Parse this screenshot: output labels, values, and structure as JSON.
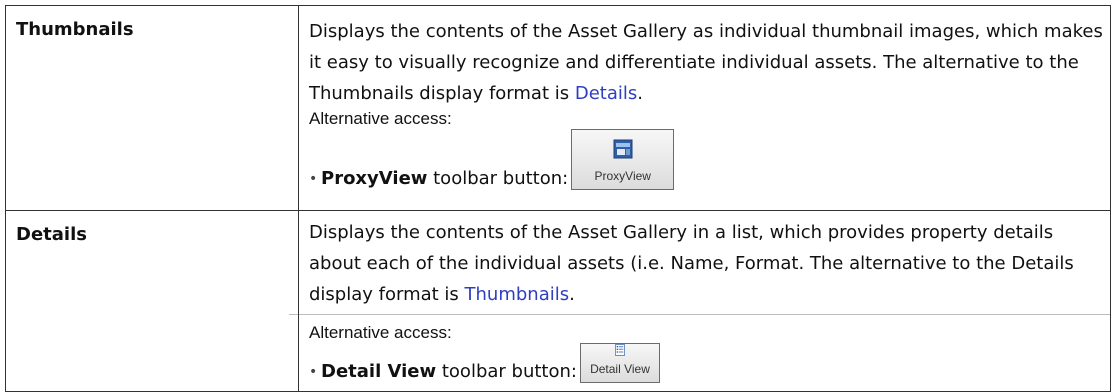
{
  "rows": [
    {
      "term": "Thumbnails",
      "desc_before": "Displays the contents of the Asset Gallery as individual thumbnail images, which makes it easy to visually recognize and differentiate individual assets. The alternative to the Thumbnails display format is ",
      "desc_link": "Details",
      "desc_after": ".",
      "alt_label": "Alternative access:",
      "alt_bullet": "•",
      "alt_bold": "ProxyView",
      "alt_rest": " toolbar button:",
      "button_label": "ProxyView",
      "button_icon": "proxyview-icon"
    },
    {
      "term": "Details",
      "desc_before": "Displays the contents of the Asset Gallery in a list, which provides property details about each of the individual assets (i.e. Name, Format. The alternative to the Details display format is ",
      "desc_link": "Thumbnails",
      "desc_after": ".",
      "alt_label": "Alternative access:",
      "alt_bullet": "•",
      "alt_bold": "Detail View",
      "alt_rest": " toolbar button:",
      "button_label": "Detail View",
      "button_icon": "detail-list-icon"
    }
  ],
  "colors": {
    "link": "#2e3ec1",
    "border": "#333333",
    "button_face": "#e6e6e6",
    "icon_blue": "#2f5fa5"
  }
}
